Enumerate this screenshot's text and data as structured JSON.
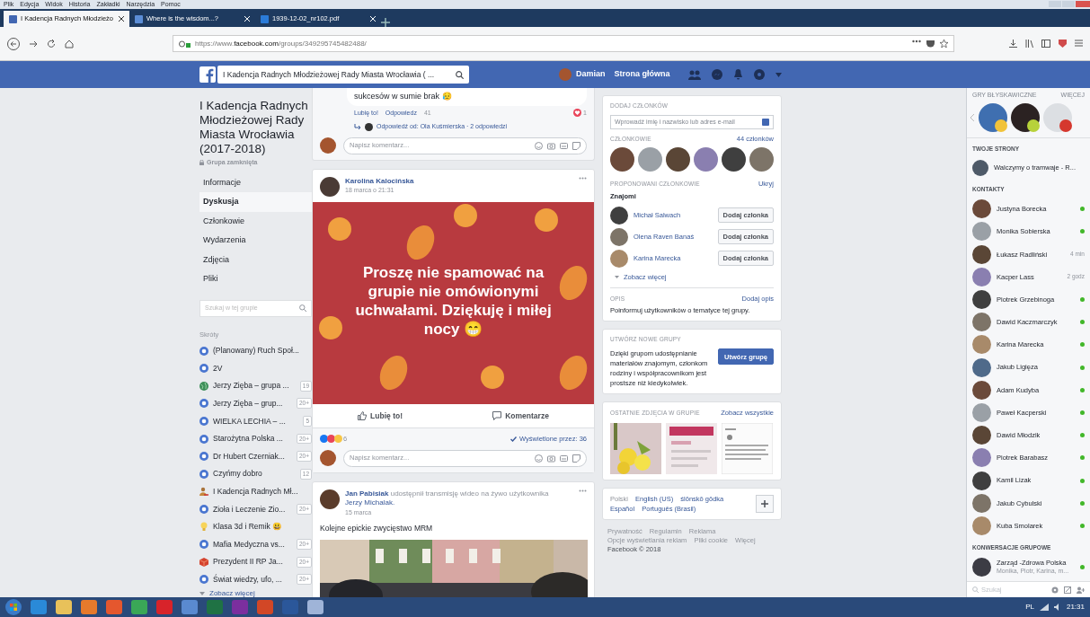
{
  "browser": {
    "menu": [
      "Plik",
      "Edycja",
      "Widok",
      "Historia",
      "Zakładki",
      "Narzędzia",
      "Pomoc"
    ],
    "tabs": [
      {
        "label": "I Kadencja Radnych Młodzieżo",
        "selected": true
      },
      {
        "label": "Where is the wisdom...?",
        "selected": false
      },
      {
        "label": "1939-12-02_nr102.pdf",
        "selected": false
      }
    ],
    "url": "https://www.**facebook.com**/groups/349295745482488/"
  },
  "fb_bar": {
    "search": "I Kadencja Radnych Młodzieżowej Rady Miasta Wrocławia ( ...",
    "user": "Damian",
    "home": "Strona główna"
  },
  "group": {
    "title": "I Kadencja Radnych Młodzieżowej Rady Miasta Wrocławia (2017-2018)",
    "privacy": "Grupa zamknięta",
    "nav": [
      {
        "label": "Informacje",
        "selected": false
      },
      {
        "label": "Dyskusja",
        "selected": true
      },
      {
        "label": "Członkowie",
        "selected": false
      },
      {
        "label": "Wydarzenia",
        "selected": false
      },
      {
        "label": "Zdjęcia",
        "selected": false
      },
      {
        "label": "Pliki",
        "selected": false
      }
    ],
    "search_placeholder": "Szukaj w tej grupie",
    "shortcuts_heading": "Skróty",
    "shortcuts": [
      {
        "label": "(Planowany) Ruch Społ...",
        "kind": "group"
      },
      {
        "label": "2V",
        "kind": "group"
      },
      {
        "label": "Jerzy Zięba – grupa ...",
        "kind": "globe",
        "count": "19"
      },
      {
        "label": "Jerzy Zięba – grup...",
        "kind": "group",
        "count": "20+"
      },
      {
        "label": "WIELKA LECHIA – ...",
        "kind": "group",
        "count": "5"
      },
      {
        "label": "Starożytna Polska ...",
        "kind": "group",
        "count": "20+"
      },
      {
        "label": "Dr Hubert Czerniak...",
        "kind": "group",
        "count": "20+"
      },
      {
        "label": "Czyńmy dobro",
        "kind": "group",
        "count": "12"
      },
      {
        "label": "I Kadencja Radnych Mł...",
        "kind": "people"
      },
      {
        "label": "Zioła i Leczenie Zio...",
        "kind": "group",
        "count": "20+"
      },
      {
        "label": "Klasa 3d i Remik 😃",
        "kind": "bulb"
      },
      {
        "label": "Mafia Medyczna vs...",
        "kind": "group",
        "count": "20+"
      },
      {
        "label": "Prezydent II RP Ja...",
        "kind": "cube",
        "count": "20+"
      },
      {
        "label": "Świat wiedzy, ufo, ...",
        "kind": "group",
        "count": "20+"
      }
    ],
    "more": "Zobacz więcej"
  },
  "comment_tail": {
    "text": "sukcesów w sumie brak 😥",
    "actions": [
      "Lubię to!",
      "Odpowiedz",
      "41"
    ],
    "reactions": "1",
    "replies": "Odpowiedź od: Ola Kuśmierska · 2 odpowiedzi",
    "composer": "Napisz komentarz..."
  },
  "posts": [
    {
      "kind": "text_image",
      "author": "Karolina Kalocińska",
      "date": "18 marca o 21:31",
      "image_text": "Proszę nie spamować na grupie nie omówionymi uchwałami. Dziękuję i miłej nocy 😁",
      "like": "Lubię to!",
      "comment": "Komentarze",
      "reactions": "6",
      "seen": "Wyświetlone przez: 36",
      "composer": "Napisz komentarz..."
    },
    {
      "kind": "video",
      "author": "Jan Pabisiak",
      "action": "udostępnił transmisję wideo na żywo użytkownika",
      "target": "Jerzy Michalak.",
      "date": "15 marca",
      "text": "Kolejne epickie zwycięstwo MRM"
    }
  ],
  "right": {
    "add_heading": "DODAJ CZŁONKÓW",
    "add_placeholder": "Wprowadź imię i nazwisko lub adres e-mail",
    "members_heading": "CZŁONKOWIE",
    "members_count": "44 członków",
    "suggested_heading": "PROPONOWANI CZŁONKOWIE",
    "hide": "Ukryj",
    "friends": "Znajomi",
    "suggested": [
      {
        "name": "Michał Salwach",
        "button": "Dodaj członka"
      },
      {
        "name": "Olena Raven Banaś",
        "button": "Dodaj członka"
      },
      {
        "name": "Karina Marecka",
        "button": "Dodaj członka"
      }
    ],
    "more": "Zobacz więcej",
    "desc_heading": "OPIS",
    "desc_action": "Dodaj opis",
    "desc_text": "Poinformuj użytkowników o tematyce tej grupy.",
    "create_heading": "UTWÓRZ NOWE GRUPY",
    "create_text": "Dzięki grupom udostępnianie materiałów znajomym, członkom rodziny i współpracownikom jest prostsze niż kiedykolwiek.",
    "create_button": "Utwórz grupę",
    "photos_heading": "OSTATNIE ZDJĘCIA W GRUPIE",
    "photos_link": "Zobacz wszystkie",
    "languages": [
      {
        "label": "Polski",
        "selected": true
      },
      {
        "label": "English (US)",
        "selected": false
      },
      {
        "label": "ślōnskŏ gŏdka",
        "selected": false
      },
      {
        "label": "Español",
        "selected": false
      },
      {
        "label": "Português (Brasil)",
        "selected": false
      }
    ],
    "footer": [
      "Prywatność",
      "Regulamin",
      "Reklama",
      "Opcje wyświetlania reklam",
      "Pliki cookie",
      "Więcej"
    ],
    "copyright": "Facebook © 2018"
  },
  "chat": {
    "games_heading": "GRY BŁYSKAWICZNE",
    "games_more": "WIĘCEJ",
    "pages_heading": "TWOJE STRONY",
    "page": "Walczymy o tramwaje - R...",
    "contacts_heading": "KONTAKTY",
    "contacts": [
      {
        "name": "Justyna Borecka",
        "online": true
      },
      {
        "name": "Monika Sobierska",
        "online": true
      },
      {
        "name": "Łukasz Radliński",
        "online": false,
        "last_active": "4 min"
      },
      {
        "name": "Kacper Lass",
        "online": false,
        "last_active": "2 godz"
      },
      {
        "name": "Piotrek Grzebinoga",
        "online": true
      },
      {
        "name": "Dawid Kaczmarczyk",
        "online": true
      },
      {
        "name": "Karina Marecka",
        "online": true
      },
      {
        "name": "Jakub Ligięza",
        "online": true
      },
      {
        "name": "Adam Kudyba",
        "online": true
      },
      {
        "name": "Paweł Kacperski",
        "online": true
      },
      {
        "name": "Dawid Młodzik",
        "online": true
      },
      {
        "name": "Piotrek Barabasz",
        "online": true
      },
      {
        "name": "Kamil Lizak",
        "online": true
      },
      {
        "name": "Jakub Cybulski",
        "online": true
      },
      {
        "name": "Kuba Smolarek",
        "online": true
      }
    ],
    "groups_heading": "KONWERSACJE GRUPOWE",
    "groups": [
      {
        "name": "Zarząd -Zdrowa Polska",
        "members": "Monika, Piotr, Karina, m...",
        "online": true
      }
    ],
    "search_placeholder": "Szukaj"
  },
  "taskbar": {
    "lang": "PL",
    "time": "21:31"
  }
}
